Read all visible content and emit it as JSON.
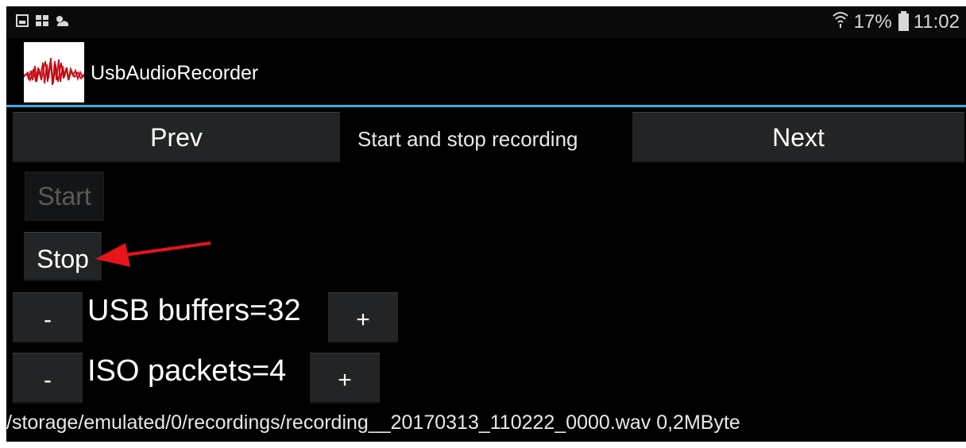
{
  "status_bar": {
    "icons": [
      "gallery-icon",
      "image-icon",
      "weather-icon"
    ],
    "wifi_icon": "wifi-icon",
    "battery_percent": "17%",
    "battery_icon": "battery-icon",
    "time": "11:02"
  },
  "app_bar": {
    "app_icon": "audio-waveform-icon",
    "title": "UsbAudioRecorder",
    "accent_color": "#33aee0"
  },
  "nav": {
    "prev_label": "Prev",
    "caption": "Start and stop recording",
    "next_label": "Next"
  },
  "controls": {
    "start_label": "Start",
    "start_enabled": false,
    "stop_label": "Stop",
    "annotation_arrow_color": "#e8141b"
  },
  "usb_buffers": {
    "minus_label": "-",
    "label": "USB buffers=32",
    "plus_label": "+"
  },
  "iso_packets": {
    "minus_label": "-",
    "label": "ISO packets=4",
    "plus_label": "+"
  },
  "recording_info": {
    "text": "/storage/emulated/0/recordings/recording__20170313_110222_0000.wav 0,2MByte"
  }
}
